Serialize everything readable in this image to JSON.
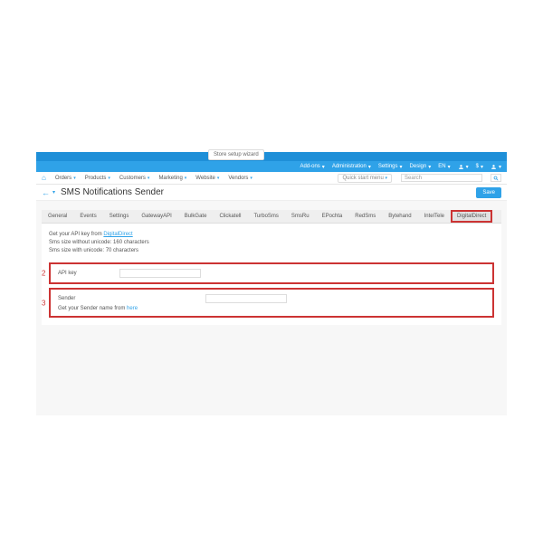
{
  "setup_wizard": "Store setup wizard",
  "topnav": {
    "addons": "Add-ons",
    "admin": "Administration",
    "settings": "Settings",
    "design": "Design",
    "lang": "EN",
    "currency": "$"
  },
  "menu": {
    "orders": "Orders",
    "products": "Products",
    "customers": "Customers",
    "marketing": "Marketing",
    "website": "Website",
    "vendors": "Vendors",
    "quick": "Quick start menu",
    "search_ph": "Search"
  },
  "page_title": "SMS Notifications Sender",
  "save": "Save",
  "tabs": [
    "General",
    "Events",
    "Settings",
    "GatewayAPI",
    "BulkGate",
    "Clickatell",
    "TurboSms",
    "SmsRu",
    "EPochta",
    "RedSms",
    "Bytehand",
    "IntelTele",
    "DigitalDirect"
  ],
  "info": {
    "l1a": "Get your API key from ",
    "l1b": "DigitalDirect",
    "l2": "Sms size without unicode: 160 characters",
    "l3": "Sms size with unicode: 70 characters"
  },
  "field1": {
    "num": "2",
    "label": "API key"
  },
  "field2": {
    "num": "3",
    "label": "Sender",
    "hint_a": "Get your Sender name from ",
    "hint_b": "here"
  }
}
